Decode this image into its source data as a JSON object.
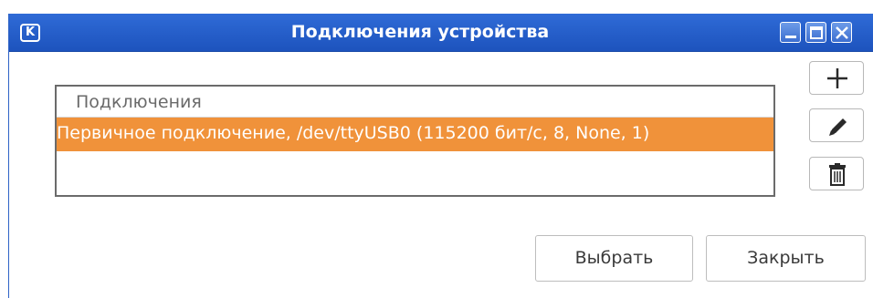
{
  "window": {
    "title": "Подключения устройства",
    "app_icon": "K",
    "controls": [
      "minimize-icon",
      "maximize-icon",
      "close-icon"
    ]
  },
  "connections": {
    "header": "Подключения",
    "rows": [
      {
        "label": "Первичное подключение, /dev/ttyUSB0 (115200 бит/с, 8, None, 1)",
        "selected": true
      }
    ]
  },
  "side_buttons": [
    "add-icon",
    "edit-icon",
    "delete-icon"
  ],
  "buttons": {
    "select_label": "Выбрать",
    "close_label": "Закрыть"
  },
  "colors": {
    "titlebar": "#2f6bd7",
    "selection": "#f0923a"
  }
}
